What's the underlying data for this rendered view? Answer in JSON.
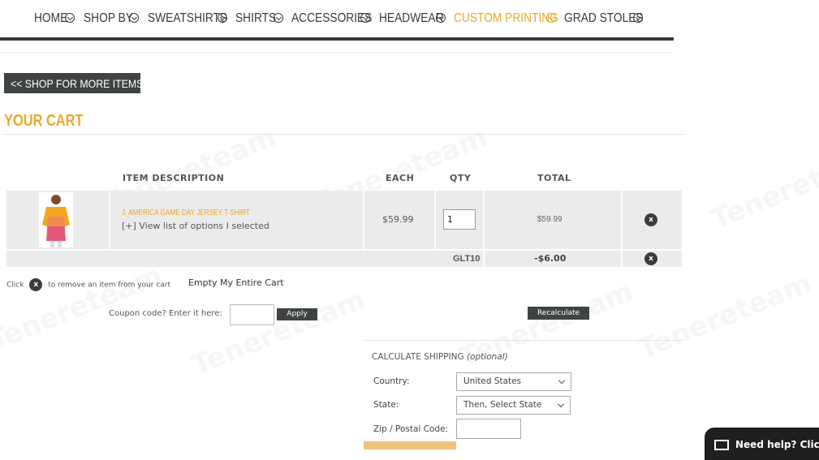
{
  "nav": {
    "items": [
      {
        "label": "HOME",
        "active": false
      },
      {
        "label": "SHOP BY",
        "active": false
      },
      {
        "label": "SWEATSHIRTS",
        "active": false
      },
      {
        "label": "SHIRTS",
        "active": false
      },
      {
        "label": "ACCESSORIES",
        "active": false
      },
      {
        "label": "HEADWEAR",
        "active": false
      },
      {
        "label": "CUSTOM PRINTING",
        "active": true
      },
      {
        "label": "GRAD STOLES",
        "active": false
      }
    ],
    "active_color": "#e8a92a"
  },
  "shop_more": {
    "label": "<< SHOP FOR MORE ITEMS"
  },
  "cart": {
    "title": "YOUR CART",
    "headers": {
      "item": "ITEM  DESCRIPTION",
      "each": "EACH",
      "qty": "QTY",
      "total": "TOTAL"
    },
    "item": {
      "name": "J. AMERICA GAME DAY JERSEY T-SHIRT",
      "options_link": "[+] View list of options I selected",
      "each": "$59.99",
      "qty": "1",
      "total": "$59.99"
    },
    "discount": {
      "code": "GLT10",
      "amount": "-$6.00"
    },
    "remove_glyph": "x",
    "remove_note_before": "Click",
    "remove_note_after": "to remove an item from your cart",
    "empty_cart": "Empty My Entire Cart"
  },
  "coupon": {
    "label": "Coupon code? Enter it here:",
    "apply": "Apply"
  },
  "recalculate": "Recalculate",
  "shipping": {
    "title": "CALCULATE SHIPPING",
    "optional": "(optional)",
    "country_label": "Country:",
    "country_value": "United States",
    "state_label": "State:",
    "state_value": "Then, Select State",
    "zip_label": "Zip / Postal Code:"
  },
  "help": {
    "label": "Need help? Click"
  },
  "watermark": "Tenereteam"
}
